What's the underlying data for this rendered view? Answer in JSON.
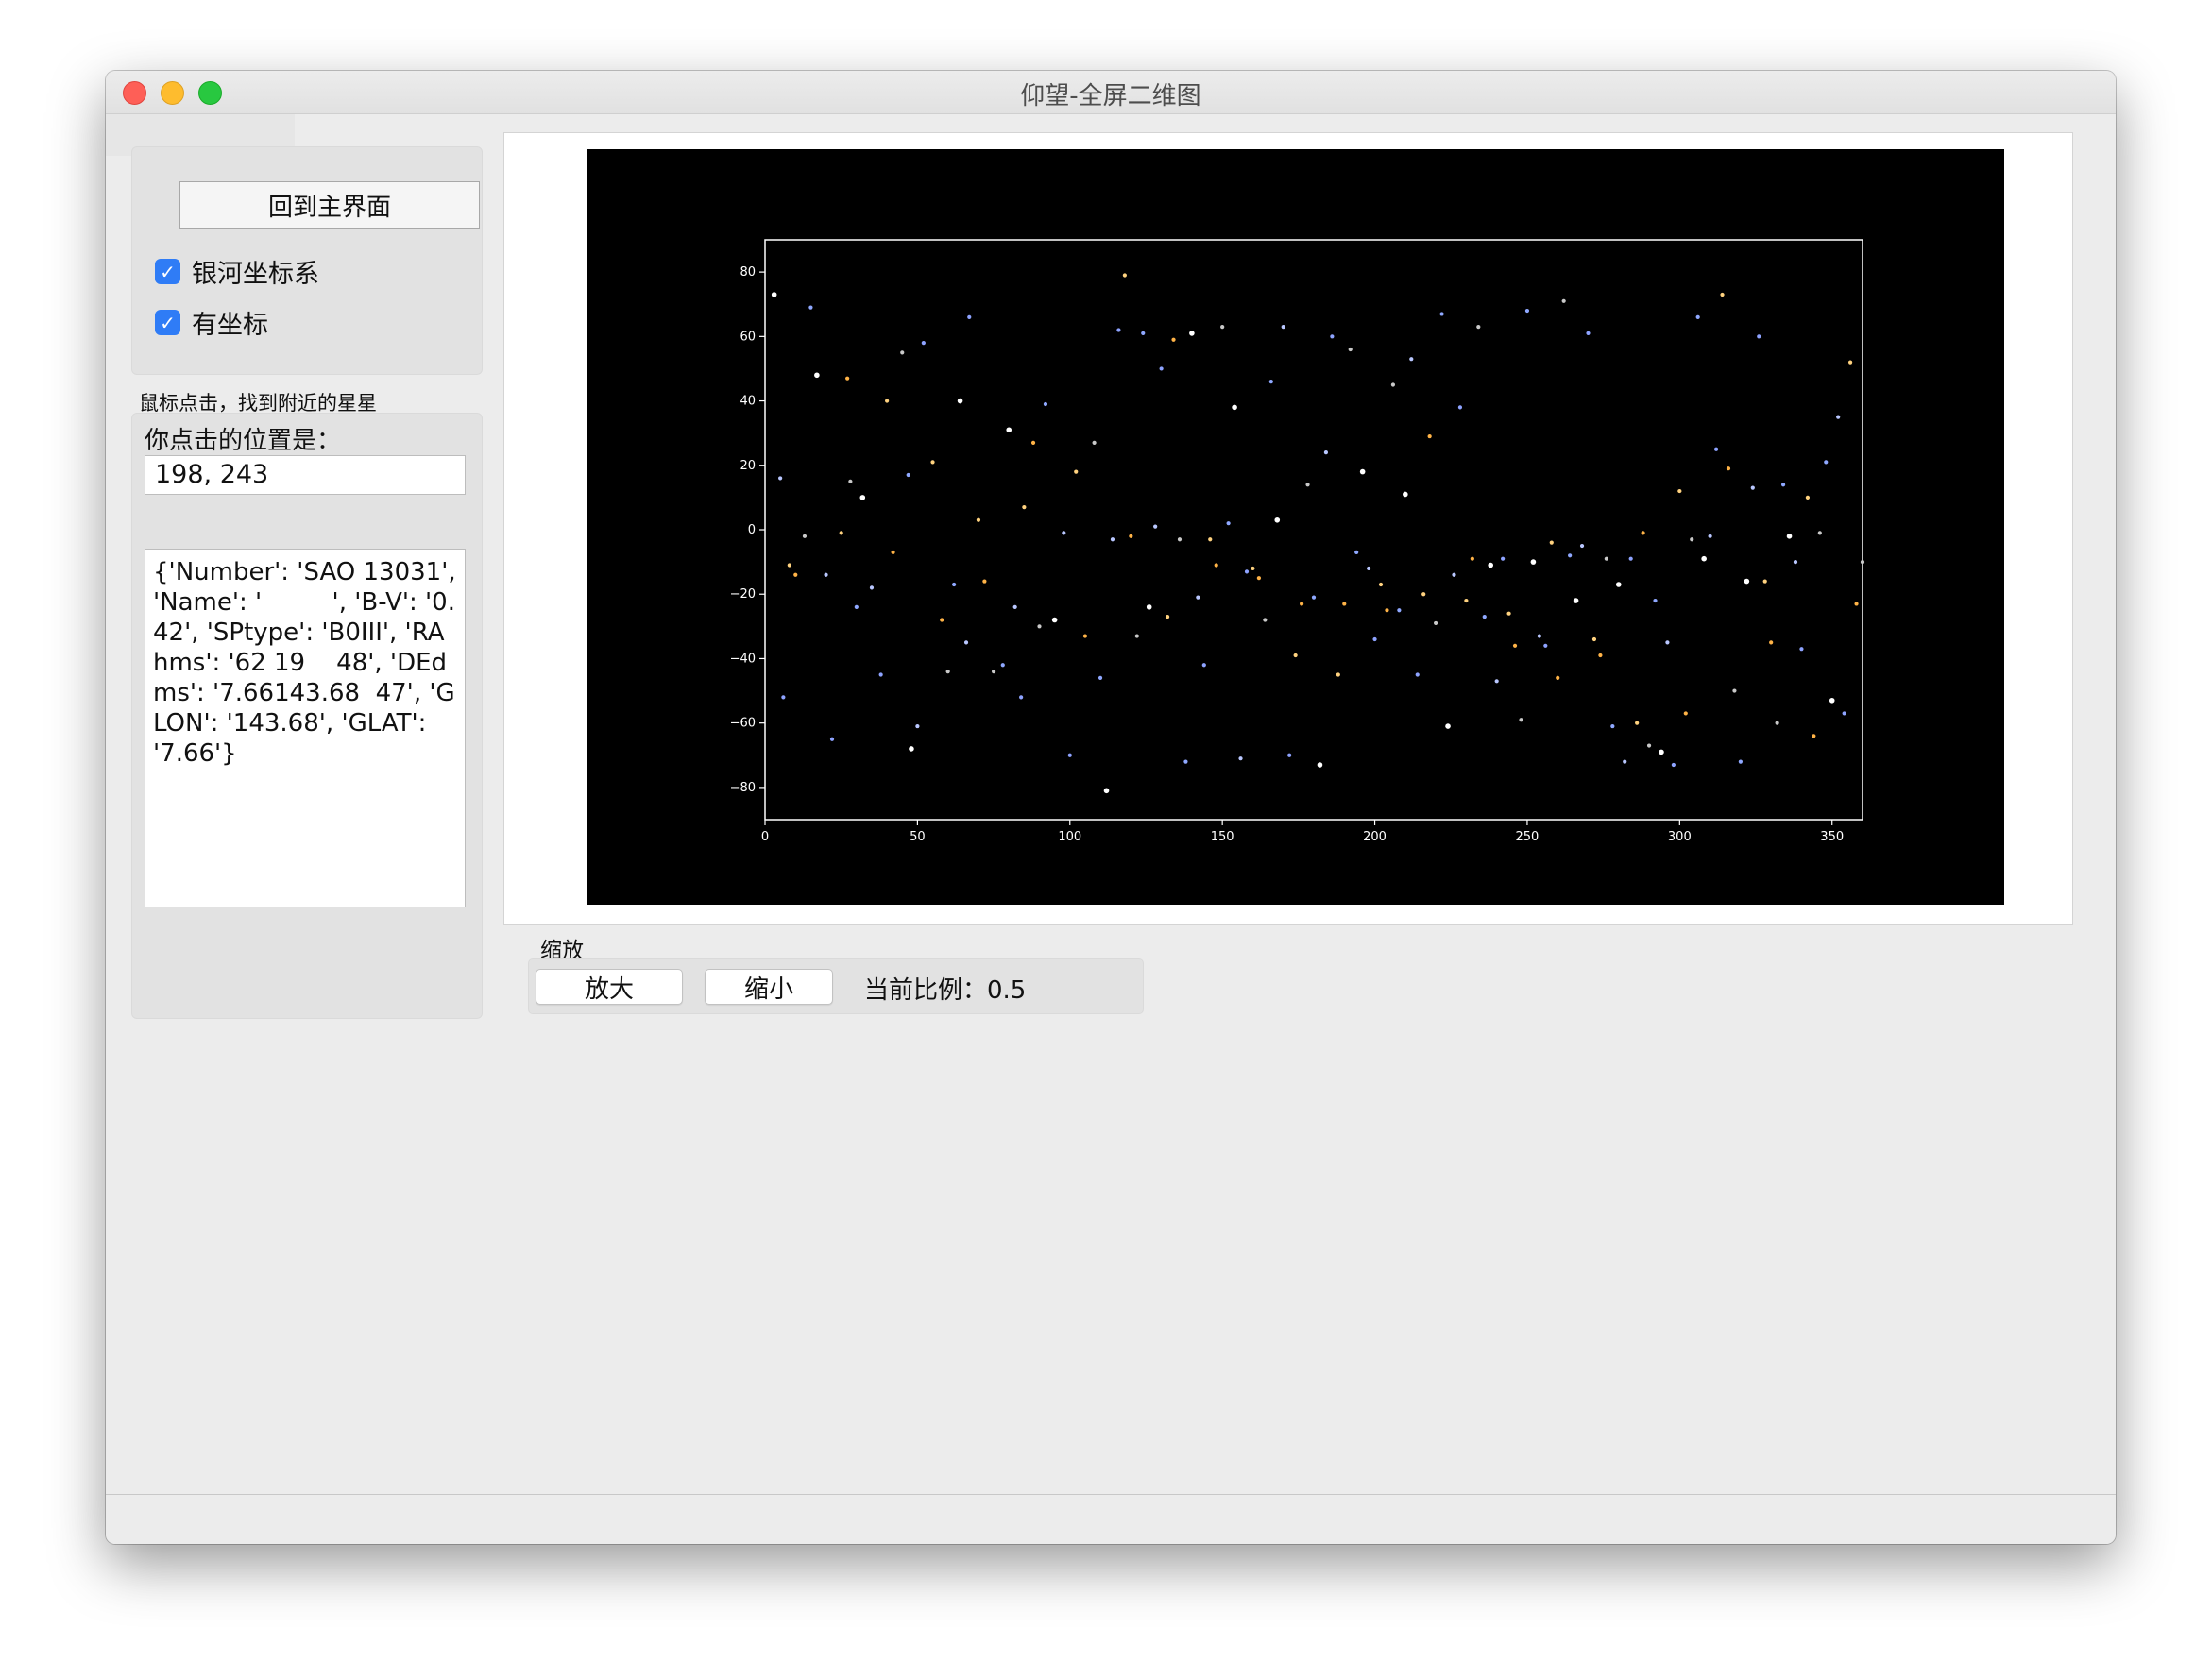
{
  "window": {
    "title": "仰望-全屏二维图"
  },
  "sidebar": {
    "home_button": "回到主界面",
    "checkbox_galactic": {
      "label": "银河坐标系",
      "checked": true
    },
    "checkbox_axes": {
      "label": "有坐标",
      "checked": true
    },
    "hint": "鼠标点击，找到附近的星星",
    "position_label": "你点击的位置是：",
    "position_value": "198, 243",
    "star_info": "{'Number': 'SAO 13031', 'Name': '         ', 'B-V': '0.42', 'SPtype': 'B0III', 'RAhms': '62 19    48', 'DEdms': '7.66143.68  47', 'GLON': '143.68', 'GLAT': '7.66'}"
  },
  "zoom": {
    "group_label": "缩放",
    "zoom_in": "放大",
    "zoom_out": "缩小",
    "current_ratio": "当前比例：0.5"
  },
  "colors": {
    "plot_background": "#000000",
    "axes": "#ffffff",
    "star_colors": [
      "#ffffff",
      "#b9c7ff",
      "#8ea3ff",
      "#ffd27f",
      "#ffb347",
      "#c9c9c9",
      "#8fa8ff"
    ]
  },
  "chart_data": {
    "type": "scatter",
    "title": "",
    "xlabel": "",
    "ylabel": "",
    "xlim": [
      0,
      360
    ],
    "ylim": [
      -90,
      90
    ],
    "xticks": [
      0,
      50,
      100,
      150,
      200,
      250,
      300,
      350
    ],
    "yticks": [
      -80,
      -60,
      -40,
      -20,
      0,
      20,
      40,
      60,
      80
    ],
    "grid": false,
    "background": "black",
    "points": [
      [
        3,
        73
      ],
      [
        5,
        16
      ],
      [
        6,
        -52
      ],
      [
        8,
        -11
      ],
      [
        10,
        -14
      ],
      [
        13,
        -2
      ],
      [
        15,
        69
      ],
      [
        17,
        48
      ],
      [
        20,
        -14
      ],
      [
        22,
        -65
      ],
      [
        25,
        -1
      ],
      [
        27,
        47
      ],
      [
        28,
        15
      ],
      [
        30,
        -24
      ],
      [
        32,
        10
      ],
      [
        35,
        -18
      ],
      [
        38,
        -45
      ],
      [
        40,
        40
      ],
      [
        42,
        -7
      ],
      [
        45,
        55
      ],
      [
        47,
        17
      ],
      [
        48,
        -68
      ],
      [
        50,
        -61
      ],
      [
        52,
        58
      ],
      [
        55,
        21
      ],
      [
        58,
        -28
      ],
      [
        60,
        -44
      ],
      [
        62,
        -17
      ],
      [
        64,
        40
      ],
      [
        66,
        -35
      ],
      [
        67,
        66
      ],
      [
        70,
        3
      ],
      [
        72,
        -16
      ],
      [
        75,
        -44
      ],
      [
        78,
        -42
      ],
      [
        80,
        31
      ],
      [
        82,
        -24
      ],
      [
        84,
        -52
      ],
      [
        85,
        7
      ],
      [
        88,
        27
      ],
      [
        90,
        -30
      ],
      [
        92,
        39
      ],
      [
        95,
        -28
      ],
      [
        98,
        -1
      ],
      [
        100,
        -70
      ],
      [
        102,
        18
      ],
      [
        105,
        -33
      ],
      [
        108,
        27
      ],
      [
        110,
        -46
      ],
      [
        112,
        -81
      ],
      [
        114,
        -3
      ],
      [
        116,
        62
      ],
      [
        118,
        79
      ],
      [
        120,
        -2
      ],
      [
        122,
        -33
      ],
      [
        124,
        61
      ],
      [
        126,
        -24
      ],
      [
        128,
        1
      ],
      [
        130,
        50
      ],
      [
        132,
        -27
      ],
      [
        134,
        59
      ],
      [
        136,
        -3
      ],
      [
        138,
        -72
      ],
      [
        140,
        61
      ],
      [
        142,
        -21
      ],
      [
        144,
        -42
      ],
      [
        146,
        -3
      ],
      [
        148,
        -11
      ],
      [
        150,
        63
      ],
      [
        152,
        2
      ],
      [
        154,
        38
      ],
      [
        156,
        -71
      ],
      [
        158,
        -13
      ],
      [
        160,
        -12
      ],
      [
        162,
        -15
      ],
      [
        164,
        -28
      ],
      [
        166,
        46
      ],
      [
        168,
        3
      ],
      [
        170,
        63
      ],
      [
        172,
        -70
      ],
      [
        174,
        -39
      ],
      [
        176,
        -23
      ],
      [
        178,
        14
      ],
      [
        180,
        -21
      ],
      [
        182,
        -73
      ],
      [
        184,
        24
      ],
      [
        186,
        60
      ],
      [
        188,
        -45
      ],
      [
        190,
        -23
      ],
      [
        192,
        56
      ],
      [
        194,
        -7
      ],
      [
        196,
        18
      ],
      [
        198,
        -12
      ],
      [
        200,
        -34
      ],
      [
        202,
        -17
      ],
      [
        204,
        -25
      ],
      [
        206,
        45
      ],
      [
        208,
        -25
      ],
      [
        210,
        11
      ],
      [
        212,
        53
      ],
      [
        214,
        -45
      ],
      [
        216,
        -20
      ],
      [
        218,
        29
      ],
      [
        220,
        -29
      ],
      [
        222,
        67
      ],
      [
        224,
        -61
      ],
      [
        226,
        -14
      ],
      [
        228,
        38
      ],
      [
        230,
        -22
      ],
      [
        232,
        -9
      ],
      [
        234,
        63
      ],
      [
        236,
        -27
      ],
      [
        238,
        -11
      ],
      [
        240,
        -47
      ],
      [
        242,
        -9
      ],
      [
        244,
        -26
      ],
      [
        246,
        -36
      ],
      [
        248,
        -59
      ],
      [
        250,
        68
      ],
      [
        252,
        -10
      ],
      [
        254,
        -33
      ],
      [
        256,
        -36
      ],
      [
        258,
        -4
      ],
      [
        260,
        -46
      ],
      [
        262,
        71
      ],
      [
        264,
        -8
      ],
      [
        266,
        -22
      ],
      [
        268,
        -5
      ],
      [
        270,
        61
      ],
      [
        272,
        -34
      ],
      [
        274,
        -39
      ],
      [
        276,
        -9
      ],
      [
        278,
        -61
      ],
      [
        280,
        -17
      ],
      [
        282,
        -72
      ],
      [
        284,
        -9
      ],
      [
        286,
        -60
      ],
      [
        288,
        -1
      ],
      [
        290,
        -67
      ],
      [
        292,
        -22
      ],
      [
        294,
        -69
      ],
      [
        296,
        -35
      ],
      [
        298,
        -73
      ],
      [
        300,
        12
      ],
      [
        302,
        -57
      ],
      [
        304,
        -3
      ],
      [
        306,
        66
      ],
      [
        308,
        -9
      ],
      [
        310,
        -2
      ],
      [
        312,
        25
      ],
      [
        314,
        73
      ],
      [
        316,
        19
      ],
      [
        318,
        -50
      ],
      [
        320,
        -72
      ],
      [
        322,
        -16
      ],
      [
        324,
        13
      ],
      [
        326,
        60
      ],
      [
        328,
        -16
      ],
      [
        330,
        -35
      ],
      [
        332,
        -60
      ],
      [
        334,
        14
      ],
      [
        336,
        -2
      ],
      [
        338,
        -10
      ],
      [
        340,
        -37
      ],
      [
        342,
        10
      ],
      [
        344,
        -64
      ],
      [
        346,
        -1
      ],
      [
        348,
        21
      ],
      [
        350,
        -53
      ],
      [
        352,
        35
      ],
      [
        354,
        -57
      ],
      [
        356,
        52
      ],
      [
        358,
        -23
      ],
      [
        360,
        -10
      ]
    ]
  }
}
